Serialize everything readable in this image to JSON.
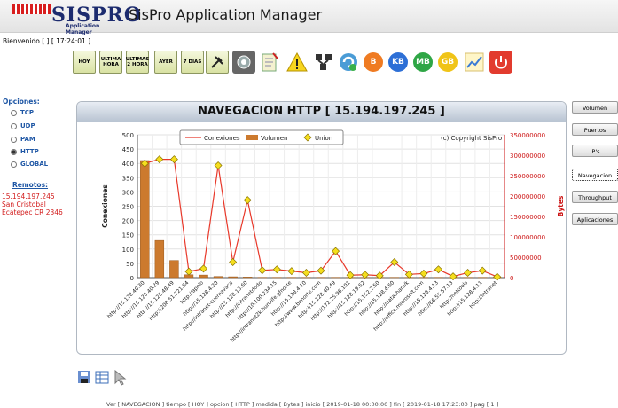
{
  "header": {
    "logo_text": "SISPRO",
    "logo_sub": "Application Manager",
    "app_title": "SisPro Application Manager"
  },
  "welcome": "Bienvenido [ ] [ 17:24:01 ]",
  "toolbar": {
    "buttons": [
      "HOY",
      "ULTIMA HORA",
      "ULTIMAS 2 HORA",
      "AYER",
      "7 DIAS"
    ],
    "icons": [
      "tools-icon",
      "network-icon",
      "server-icon",
      "notepad-icon",
      "warning-icon",
      "topology-icon",
      "refresh-icon",
      "b-icon",
      "kb-icon",
      "mb-icon",
      "gb-icon",
      "graph-icon",
      "power-icon"
    ],
    "ball_labels": {
      "b": "B",
      "kb": "KB",
      "mb": "MB",
      "gb": "GB"
    }
  },
  "options": {
    "title": "Opciones:",
    "items": [
      "TCP",
      "UDP",
      "PAM",
      "HTTP",
      "GLOBAL"
    ],
    "selected": "HTTP",
    "remotos_title": "Remotos:",
    "remote_lines": [
      "15.194.197.245",
      "San Cristobal",
      "Ecatepec CR 2346"
    ]
  },
  "panel": {
    "title": "NAVEGACION HTTP [ 15.194.197.245 ]"
  },
  "side_menu": [
    "Volumen",
    "Puertos",
    "IP's",
    "Navegacion",
    "Throughput",
    "Aplicaciones"
  ],
  "side_menu_active": "Navegacion",
  "footer": "Ver [ NAVEGACION ] tiempo [ HOY ] opcion [ HTTP ] medida [ Bytes ] inicio [ 2019-01-18 00:00:00 ] fin [ 2019-01-18 17:23:00 ] pag [ 1 ]",
  "chart_data": {
    "type": "bar",
    "copyright": "(c) Copyright SisPro",
    "legend": [
      "Conexiones",
      "Volumen",
      "Union"
    ],
    "legend_position": "top-center",
    "ylabel": "Conexiones",
    "y2label": "Bytes",
    "ylim": [
      0,
      500
    ],
    "y2lim": [
      0,
      350000000
    ],
    "yticks": [
      0,
      50,
      100,
      150,
      200,
      250,
      300,
      350,
      400,
      450,
      500
    ],
    "y2ticks": [
      0,
      50000000,
      100000000,
      150000000,
      200000000,
      250000000,
      300000000,
      350000000
    ],
    "grid": true,
    "colors": {
      "conexiones": "#e8382a",
      "volumen": "#cc7a2e",
      "union": "#f5de1e",
      "axis2": "#cc1111"
    },
    "categories": [
      "http://15.128.40.30",
      "http://15.128.40.29",
      "http://15.128.48.49",
      "http://208.51.221.84",
      "http://apolo",
      "http://15.128.4.20",
      "http://intranet-cuernavaca",
      "http://15.128.13.60",
      "http://intranetdodo",
      "http://10.100.234.15",
      "http://intranet2k.burolife.gfnorte",
      "http://15.128.4.10",
      "http://www.banorte.com",
      "http://15.128.40.49",
      "http://172.25.96.101",
      "http://15.128.19.62",
      "http://15.152.2.50",
      "http://15.128.4.60",
      "http://datashare/k",
      "http://office.microsoft.com",
      "http://15.128.4.13",
      "http://66.55.57.13",
      "http://nettools",
      "http://15.128.4.11",
      "http://intranet"
    ],
    "series": [
      {
        "name": "Conexiones",
        "values": [
          410,
          130,
          60,
          10,
          9,
          4,
          3,
          2,
          1,
          1,
          1,
          1,
          1,
          1,
          1,
          1,
          1,
          1,
          1,
          1,
          1,
          1,
          1,
          1,
          1
        ]
      },
      {
        "name": "Volumen",
        "values": [
          280000000,
          290000000,
          290000000,
          15000000,
          22000000,
          275000000,
          38000000,
          190000000,
          18000000,
          20000000,
          16000000,
          12000000,
          17000000,
          65000000,
          6000000,
          7000000,
          5000000,
          38000000,
          8000000,
          10000000,
          20000000,
          3000000,
          12000000,
          17000000,
          2000000
        ]
      },
      {
        "name": "Union",
        "values": [
          280000000,
          290000000,
          290000000,
          15000000,
          22000000,
          275000000,
          38000000,
          190000000,
          18000000,
          20000000,
          16000000,
          12000000,
          17000000,
          65000000,
          6000000,
          7000000,
          5000000,
          38000000,
          8000000,
          10000000,
          20000000,
          3000000,
          12000000,
          17000000,
          2000000
        ]
      }
    ]
  }
}
